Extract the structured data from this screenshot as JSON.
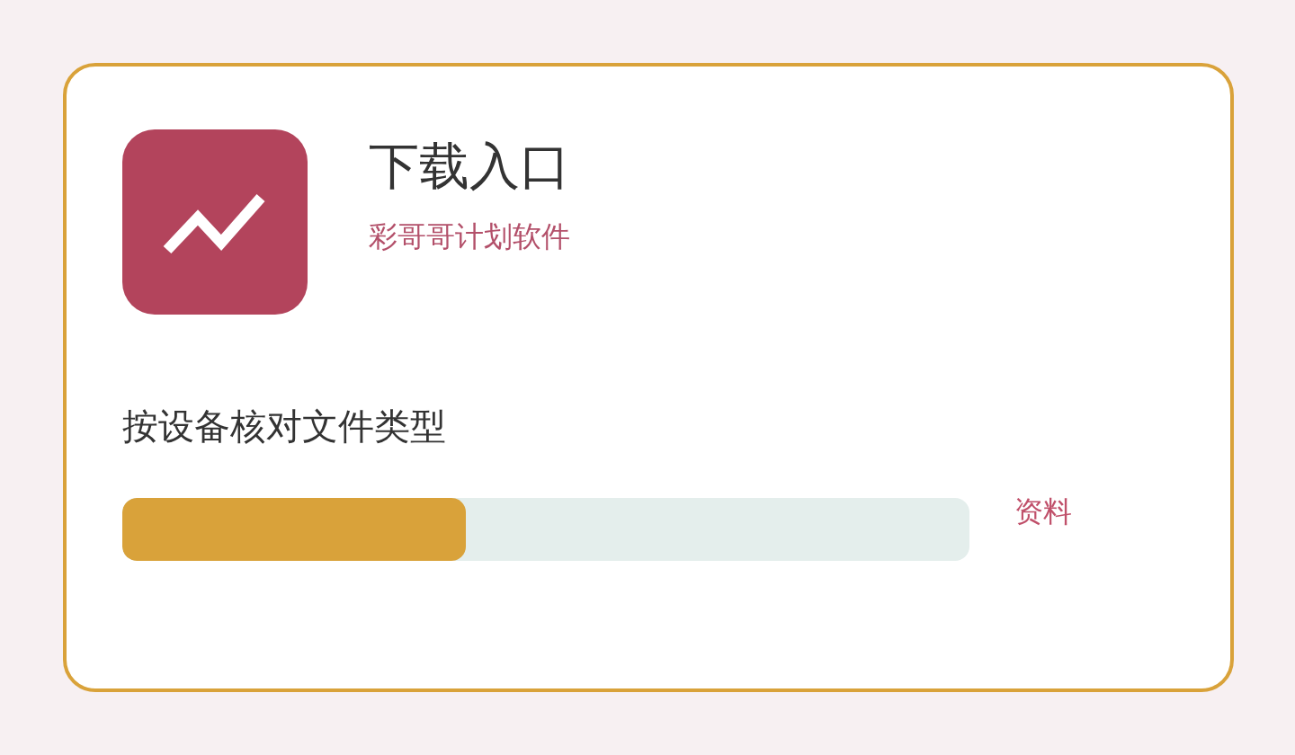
{
  "app": {
    "title": "下载入口",
    "subtitle": "彩哥哥计划软件"
  },
  "description": "按设备核对文件类型",
  "progress": {
    "level": 0.405
  },
  "link": "资料"
}
